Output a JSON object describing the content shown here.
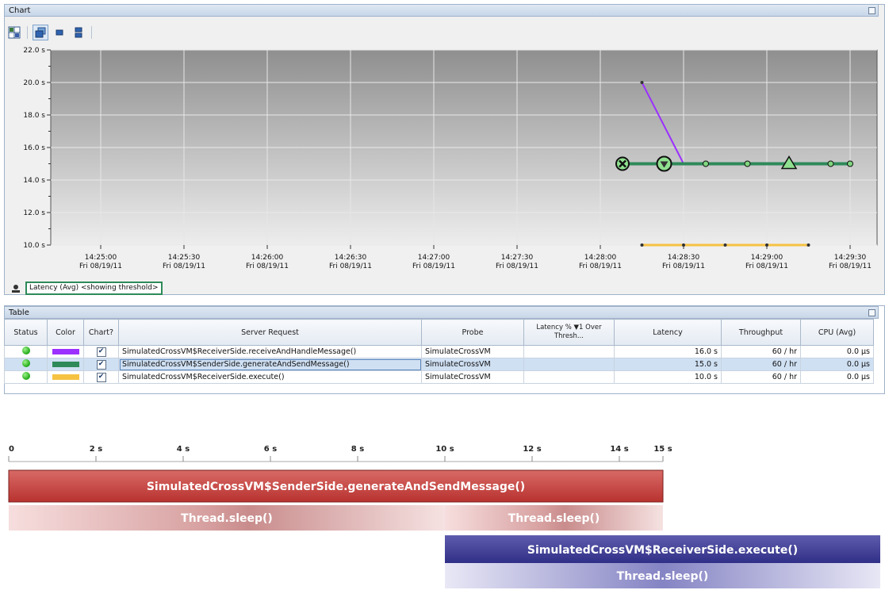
{
  "chart_pane": {
    "title": "Chart",
    "toolbar": [
      {
        "icon": "grid-layout-icon",
        "active": false
      },
      {
        "icon": "overlay-charts-icon",
        "active": true
      },
      {
        "icon": "single-chart-icon",
        "active": false
      },
      {
        "icon": "stacked-charts-icon",
        "active": false
      }
    ],
    "legend_label": "Latency (Avg) <showing threshold>"
  },
  "chart_data": {
    "type": "line",
    "ylim": [
      10,
      22
    ],
    "y_ticks": [
      "10.0 s",
      "12.0 s",
      "14.0 s",
      "16.0 s",
      "18.0 s",
      "20.0 s",
      "22.0 s"
    ],
    "x_ticks": [
      {
        "time": "14:25:00",
        "date": "Fri 08/19/11"
      },
      {
        "time": "14:25:30",
        "date": "Fri 08/19/11"
      },
      {
        "time": "14:26:00",
        "date": "Fri 08/19/11"
      },
      {
        "time": "14:26:30",
        "date": "Fri 08/19/11"
      },
      {
        "time": "14:27:00",
        "date": "Fri 08/19/11"
      },
      {
        "time": "14:27:30",
        "date": "Fri 08/19/11"
      },
      {
        "time": "14:28:00",
        "date": "Fri 08/19/11"
      },
      {
        "time": "14:28:30",
        "date": "Fri 08/19/11"
      },
      {
        "time": "14:29:00",
        "date": "Fri 08/19/11"
      },
      {
        "time": "14:29:30",
        "date": "Fri 08/19/11"
      }
    ],
    "series": [
      {
        "color": "#9b30ff",
        "x": [
          "14:28:15",
          "14:28:30"
        ],
        "values": [
          20.0,
          15.0
        ]
      },
      {
        "color": "#2e8a5a",
        "x": [
          "14:28:08",
          "14:28:23",
          "14:28:38",
          "14:28:53",
          "14:29:08",
          "14:29:23",
          "14:29:30"
        ],
        "values": [
          15.0,
          15.0,
          15.0,
          15.0,
          15.0,
          15.0,
          15.0
        ]
      },
      {
        "color": "#f5c242",
        "x": [
          "14:28:15",
          "14:28:30",
          "14:28:45",
          "14:29:00",
          "14:29:15"
        ],
        "values": [
          10.0,
          10.0,
          10.0,
          10.0,
          10.0
        ]
      }
    ]
  },
  "table_pane": {
    "title": "Table",
    "columns": [
      "Status",
      "Color",
      "Chart?",
      "Server Request",
      "Probe",
      "Latency % ▼1 Over Thresh...",
      "Latency",
      "Throughput",
      "CPU (Avg)"
    ],
    "rows": [
      {
        "status": "ok",
        "color": "#9b30ff",
        "chart": "✔",
        "request": "SimulatedCrossVM$ReceiverSide.receiveAndHandleMessage()",
        "probe": "SimulateCrossVM",
        "latency_pct": "",
        "latency": "16.0 s",
        "throughput": "60 / hr",
        "cpu": "0.0 µs"
      },
      {
        "status": "ok",
        "color": "#2e8a5a",
        "chart": "✔",
        "request": "SimulatedCrossVM$SenderSide.generateAndSendMessage()",
        "probe": "SimulateCrossVM",
        "latency_pct": "",
        "latency": "15.0 s",
        "throughput": "60 / hr",
        "cpu": "0.0 µs",
        "selected": true
      },
      {
        "status": "ok",
        "color": "#f5c242",
        "chart": "✔",
        "request": "SimulatedCrossVM$ReceiverSide.execute()",
        "probe": "SimulateCrossVM",
        "latency_pct": "",
        "latency": "10.0 s",
        "throughput": "60 / hr",
        "cpu": "0.0 µs"
      }
    ]
  },
  "timeline": {
    "axis_labels": [
      "0",
      "2 s",
      "4 s",
      "6 s",
      "8 s",
      "10 s",
      "12 s",
      "14 s",
      "15 s"
    ],
    "axis_values": [
      0,
      2,
      4,
      6,
      8,
      10,
      12,
      14,
      15
    ],
    "bars": [
      {
        "label": "SimulatedCrossVM$SenderSide.generateAndSendMessage()",
        "start": 0,
        "end": 15,
        "style": "solid-red"
      },
      {
        "label": "Thread.sleep()",
        "start": 0,
        "end": 10,
        "style": "fade-red"
      },
      {
        "label": "Thread.sleep()",
        "start": 10,
        "end": 15,
        "style": "fade-red"
      },
      {
        "label": "SimulatedCrossVM$ReceiverSide.execute()",
        "start": 10,
        "end": 20,
        "style": "solid-blue"
      },
      {
        "label": "Thread.sleep()",
        "start": 10,
        "end": 20,
        "style": "fade-blue"
      }
    ]
  }
}
